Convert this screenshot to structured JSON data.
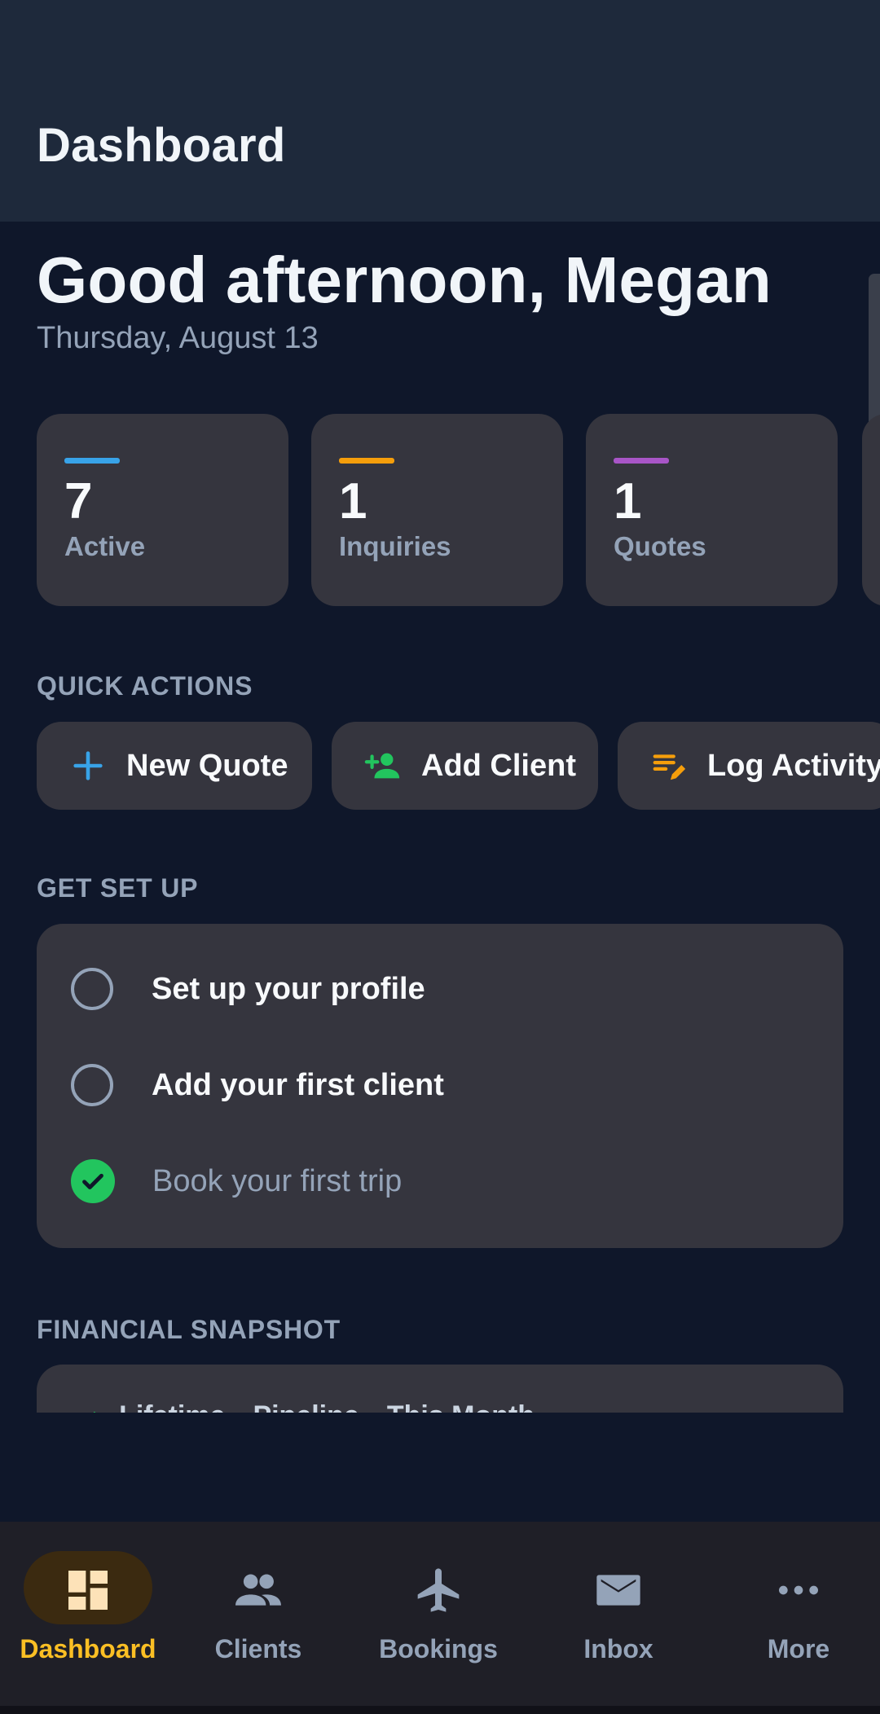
{
  "topbar": {
    "title": "Dashboard"
  },
  "greeting": {
    "text": "Good afternoon, Megan",
    "date": "Thursday, August 13"
  },
  "stats": [
    {
      "value": "7",
      "label": "Active",
      "accent": "#38a3e8"
    },
    {
      "value": "1",
      "label": "Inquiries",
      "accent": "#f59e0b"
    },
    {
      "value": "1",
      "label": "Quotes",
      "accent": "#a855c7"
    }
  ],
  "quick_actions": {
    "heading": "QUICK ACTIONS",
    "items": [
      {
        "label": "New Quote",
        "icon": "plus-icon",
        "color": "#38a3e8"
      },
      {
        "label": "Add Client",
        "icon": "person-add-icon",
        "color": "#22c55e"
      },
      {
        "label": "Log Activity",
        "icon": "edit-note-icon",
        "color": "#f59e0b"
      }
    ]
  },
  "setup": {
    "heading": "GET SET UP",
    "items": [
      {
        "label": "Set up your profile",
        "done": false
      },
      {
        "label": "Add your first client",
        "done": false
      },
      {
        "label": "Book your first trip",
        "done": true
      }
    ]
  },
  "financial": {
    "heading": "FINANCIAL SNAPSHOT",
    "tabs": [
      "Lifetime",
      "Pipeline",
      "This Month"
    ]
  },
  "nav": {
    "items": [
      {
        "label": "Dashboard",
        "icon": "dashboard-icon",
        "active": true
      },
      {
        "label": "Clients",
        "icon": "people-icon",
        "active": false
      },
      {
        "label": "Bookings",
        "icon": "airplane-icon",
        "active": false
      },
      {
        "label": "Inbox",
        "icon": "mail-icon",
        "active": false
      },
      {
        "label": "More",
        "icon": "more-horizontal-icon",
        "active": false
      }
    ],
    "active_color": "#fbbf24"
  }
}
